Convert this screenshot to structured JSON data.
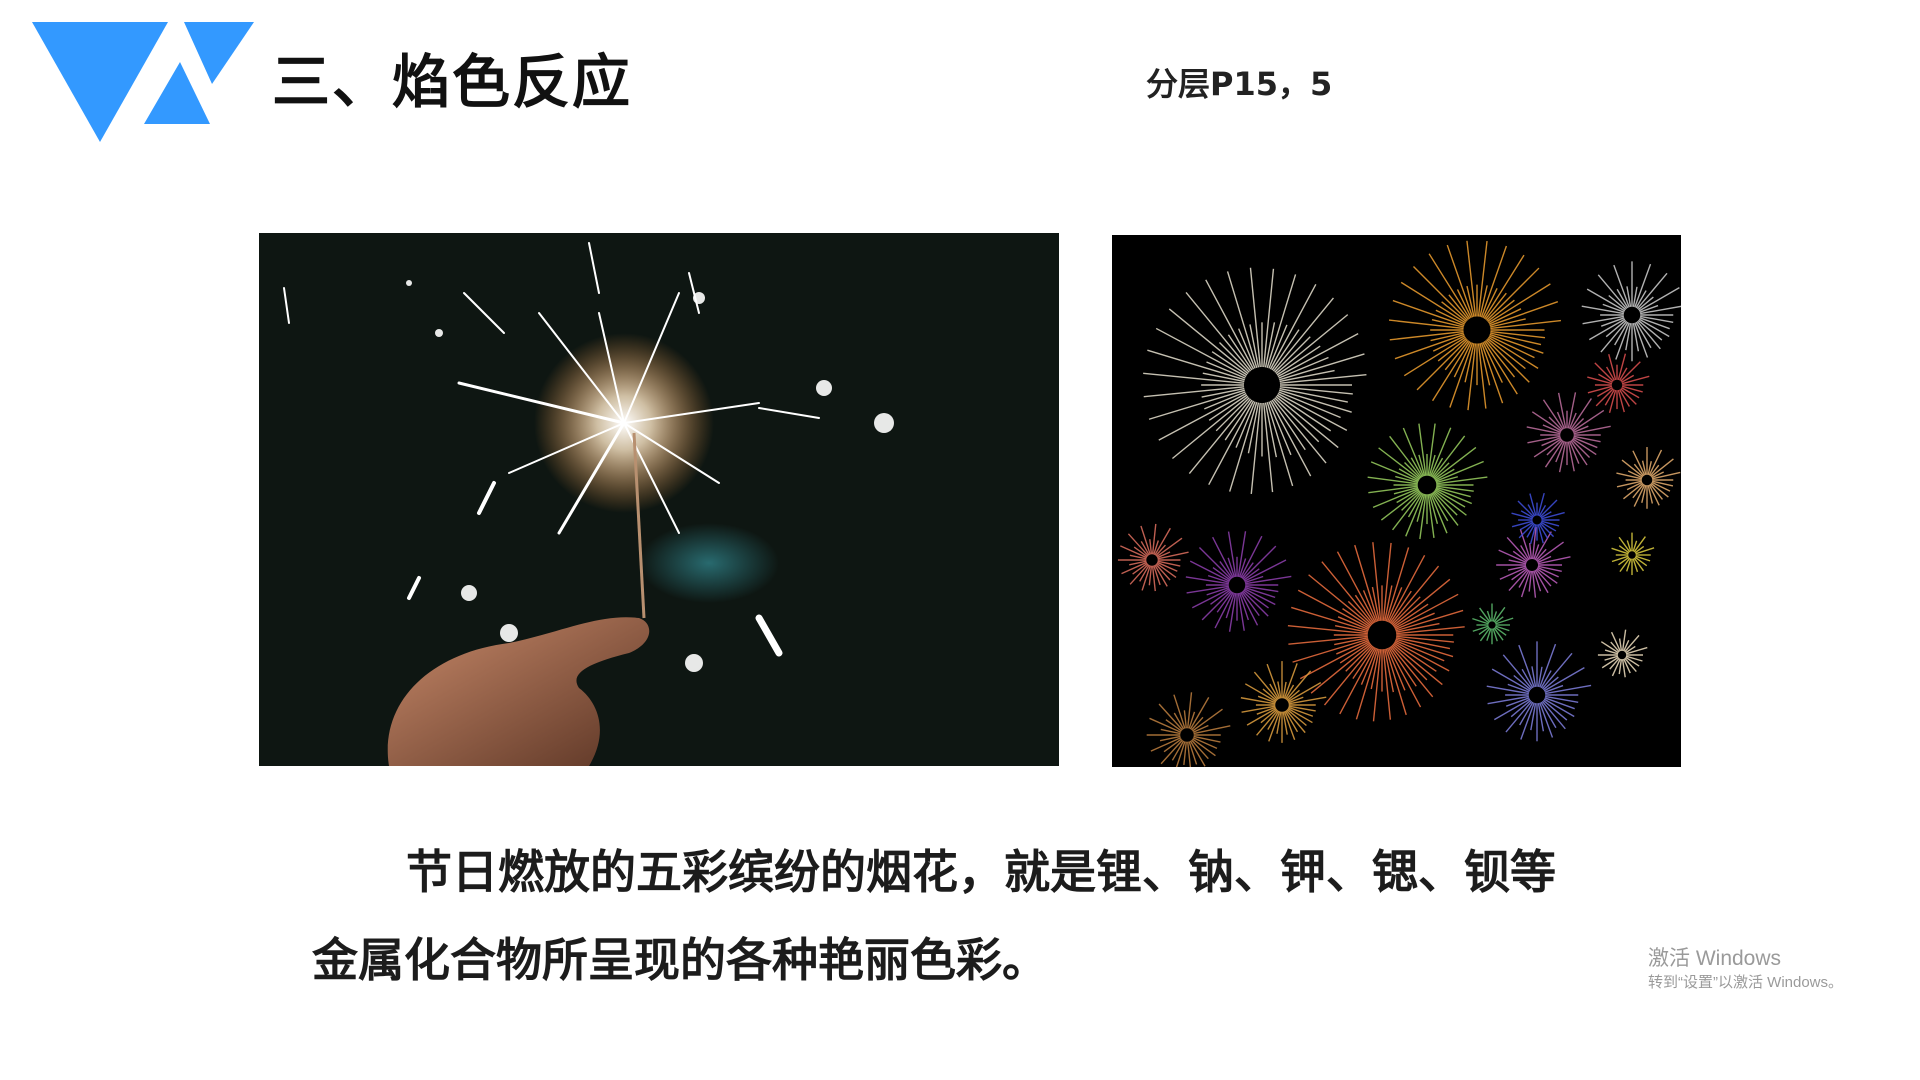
{
  "slide": {
    "title": "三、焰色反应",
    "reference": "分层P15，5",
    "paragraph_line1": "节日燃放的五彩缤纷的烟花，就是锂、钠、钾、锶、钡等",
    "paragraph_line2": "金属化合物所呈现的各种艳丽色彩。"
  },
  "watermark": {
    "line1": "激活 Windows",
    "line2": "转到“设置”以激活 Windows。"
  },
  "colors": {
    "logo_blue": "#3399ff",
    "text": "#1c1c1c",
    "watermark": "#9a9a9a"
  },
  "icons": {
    "logo": "logo-icon"
  }
}
